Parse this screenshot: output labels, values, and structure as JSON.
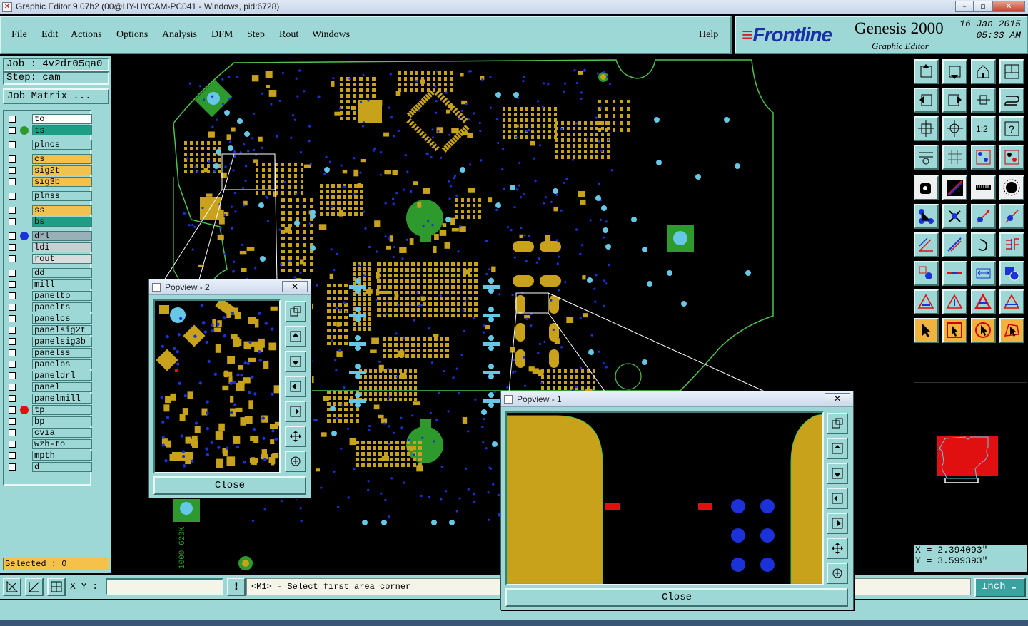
{
  "window": {
    "title": "Graphic Editor 9.07b2 (00@HY-HYCAM-PC041 - Windows, pid:6728)",
    "controls": [
      "–",
      "▫",
      "✕"
    ]
  },
  "menu": {
    "items": [
      "File",
      "Edit",
      "Actions",
      "Options",
      "Analysis",
      "DFM",
      "Step",
      "Rout",
      "Windows"
    ],
    "help": "Help"
  },
  "brand": {
    "logo_mark": "≡",
    "logo_text": "Frontline",
    "product": "Genesis 2000",
    "subtitle": "Graphic Editor",
    "date": "16 Jan 2015",
    "time": "05:33 AM"
  },
  "job": {
    "job_label": "Job : 4v2dr05qa0",
    "step_label": "Step: cam",
    "matrix_button": "Job Matrix ..."
  },
  "layers": [
    {
      "name": "to",
      "bg": "#ffffff",
      "dot": ""
    },
    {
      "name": "ts",
      "bg": "#1f9e86",
      "dot": "#2e9a2e"
    },
    {
      "name": "plncs",
      "bg": "#9ed8d6",
      "dot": ""
    },
    {
      "name": "cs",
      "bg": "#f4c24a",
      "dot": ""
    },
    {
      "name": "sig2t",
      "bg": "#f4c24a",
      "dot": ""
    },
    {
      "name": "sig3b",
      "bg": "#f4c24a",
      "dot": ""
    },
    {
      "name": "plnss",
      "bg": "#9ed8d6",
      "dot": ""
    },
    {
      "name": "ss",
      "bg": "#f4c24a",
      "dot": ""
    },
    {
      "name": "bs",
      "bg": "#1f9e86",
      "dot": ""
    },
    {
      "name": "drl",
      "bg": "#9ab0b8",
      "dot": "#1a32d8"
    },
    {
      "name": "ldi",
      "bg": "#c8d0d4",
      "dot": ""
    },
    {
      "name": "rout",
      "bg": "#d8dcdc",
      "dot": ""
    },
    {
      "name": "dd",
      "bg": "#9ed8d6",
      "dot": ""
    },
    {
      "name": "mill",
      "bg": "#9ed8d6",
      "dot": ""
    },
    {
      "name": "panelto",
      "bg": "#9ed8d6",
      "dot": ""
    },
    {
      "name": "panelts",
      "bg": "#9ed8d6",
      "dot": ""
    },
    {
      "name": "panelcs",
      "bg": "#9ed8d6",
      "dot": ""
    },
    {
      "name": "panelsig2t",
      "bg": "#9ed8d6",
      "dot": ""
    },
    {
      "name": "panelsig3b",
      "bg": "#9ed8d6",
      "dot": ""
    },
    {
      "name": "panelss",
      "bg": "#9ed8d6",
      "dot": ""
    },
    {
      "name": "panelbs",
      "bg": "#9ed8d6",
      "dot": ""
    },
    {
      "name": "paneldrl",
      "bg": "#9ed8d6",
      "dot": ""
    },
    {
      "name": "panel",
      "bg": "#9ed8d6",
      "dot": ""
    },
    {
      "name": "panelmill",
      "bg": "#9ed8d6",
      "dot": ""
    },
    {
      "name": "tp",
      "bg": "#9ed8d6",
      "dot": "#e01010"
    },
    {
      "name": "bp",
      "bg": "#9ed8d6",
      "dot": ""
    },
    {
      "name": "cvia",
      "bg": "#9ed8d6",
      "dot": ""
    },
    {
      "name": "wzh-to",
      "bg": "#9ed8d6",
      "dot": ""
    },
    {
      "name": "mpth",
      "bg": "#9ed8d6",
      "dot": ""
    },
    {
      "name": "d",
      "bg": "#9ed8d6",
      "dot": ""
    }
  ],
  "selected_label": "Selected : 0",
  "board_marking": "1000 623K",
  "coords": {
    "x": "X = 2.394093\"",
    "y": "Y = 3.599393\""
  },
  "bottom": {
    "xy_label": "X Y :",
    "xy_value": "",
    "alert": "!",
    "prompt": "<M1> - Select first area corner",
    "unit": "Inch"
  },
  "popup2": {
    "title": "Popview - 2",
    "close": "Close",
    "x": "✕"
  },
  "popup1": {
    "title": "Popview - 1",
    "close": "Close",
    "x": "✕"
  },
  "colors": {
    "panel": "#9ed8d6",
    "copper": "#c8a21a",
    "drill": "#1a32d8",
    "via": "#67c7e6",
    "mask_green": "#2e9a2e",
    "outline": "#4fc14f",
    "red_pad": "#e01010"
  }
}
